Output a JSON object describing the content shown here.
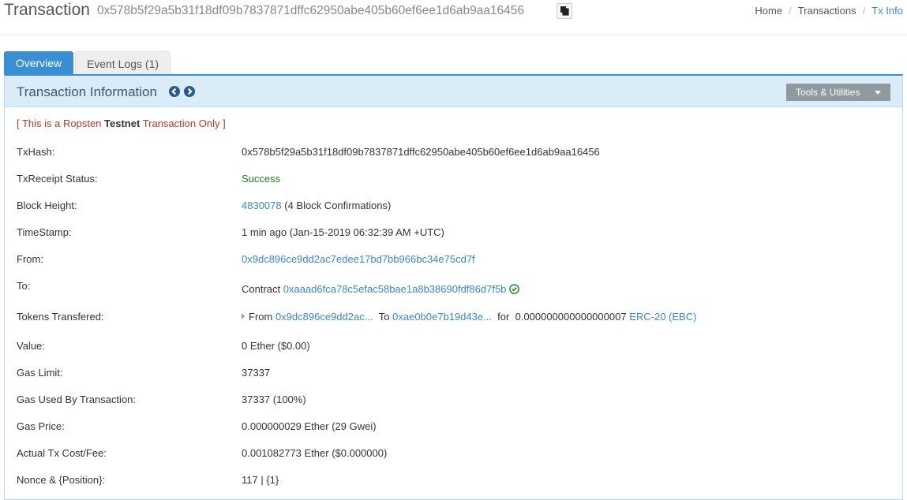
{
  "header": {
    "title": "Transaction",
    "hash": "0x578b5f29a5b31f18df09b7837871dffc62950abe405b60ef6ee1d6ab9aa16456",
    "breadcrumb": [
      "Home",
      "Transactions",
      "Tx Info"
    ]
  },
  "tabs": [
    {
      "label": "Overview",
      "active": true
    },
    {
      "label": "Event Logs (1)",
      "active": false
    }
  ],
  "panel": {
    "title": "Transaction Information",
    "tools_label": "Tools & Utilities",
    "notice_prefix": "[ This is a Ropsten ",
    "notice_bold": "Testnet",
    "notice_suffix": " Transaction Only ]"
  },
  "fields": {
    "txhash": {
      "label": "TxHash:",
      "value": "0x578b5f29a5b31f18df09b7837871dffc62950abe405b60ef6ee1d6ab9aa16456"
    },
    "status": {
      "label": "TxReceipt Status:",
      "value": "Success"
    },
    "block": {
      "label": "Block Height:",
      "link": "4830078",
      "suffix": " (4 Block Confirmations)"
    },
    "timestamp": {
      "label": "TimeStamp:",
      "value": "1 min ago (Jan-15-2019 06:32:39 AM +UTC)"
    },
    "from": {
      "label": "From:",
      "value": "0x9dc896ce9dd2ac7edee17bd7bb966bc34e75cd7f"
    },
    "to": {
      "label": "To:",
      "prefix": "Contract ",
      "value": "0xaaad6fca78c5efac58bae1a8b38690fdf86d7f5b"
    },
    "tokens": {
      "label": "Tokens Transfered:",
      "from_word": "From ",
      "from": "0x9dc896ce9dd2ac...",
      "to_word": "To ",
      "to": "0xae0b0e7b19d43e...",
      "for_word": "for",
      "amount": "0.000000000000000007",
      "token": "ERC-20 (EBC)"
    },
    "value": {
      "label": "Value:",
      "value": "0 Ether ($0.00)"
    },
    "gas_limit": {
      "label": "Gas Limit:",
      "value": "37337"
    },
    "gas_used": {
      "label": "Gas Used By Transaction:",
      "value": "37337 (100%)"
    },
    "gas_price": {
      "label": "Gas Price:",
      "value": "0.000000029 Ether (29 Gwei)"
    },
    "fee": {
      "label": "Actual Tx Cost/Fee:",
      "value": "0.001082773 Ether ($0.000000)"
    },
    "nonce": {
      "label": "Nonce & {Position}:",
      "value": "117 | {1}"
    }
  },
  "colors": {
    "accent": "#3a8fd3",
    "link": "#3a87c7",
    "success": "#1e7e24",
    "notice": "#b23b2d"
  }
}
